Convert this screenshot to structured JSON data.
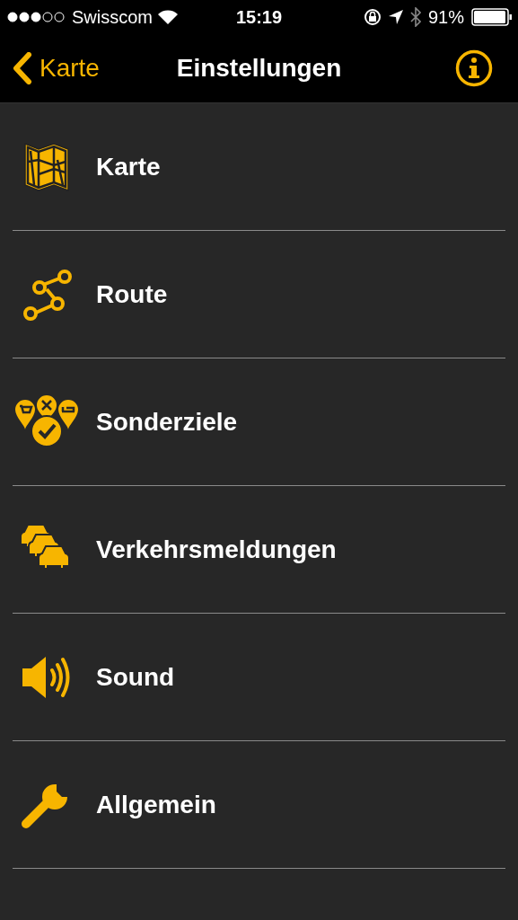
{
  "status_bar": {
    "carrier": "Swisscom",
    "time": "15:19",
    "battery": "91%"
  },
  "nav_bar": {
    "back_label": "Karte",
    "title": "Einstellungen"
  },
  "items": [
    {
      "label": "Karte",
      "kind": "map"
    },
    {
      "label": "Route",
      "kind": "route"
    },
    {
      "label": "Sonderziele",
      "kind": "poi"
    },
    {
      "label": "Verkehrsmeldungen",
      "kind": "traffic"
    },
    {
      "label": "Sound",
      "kind": "sound"
    },
    {
      "label": "Allgemein",
      "kind": "wrench"
    }
  ]
}
